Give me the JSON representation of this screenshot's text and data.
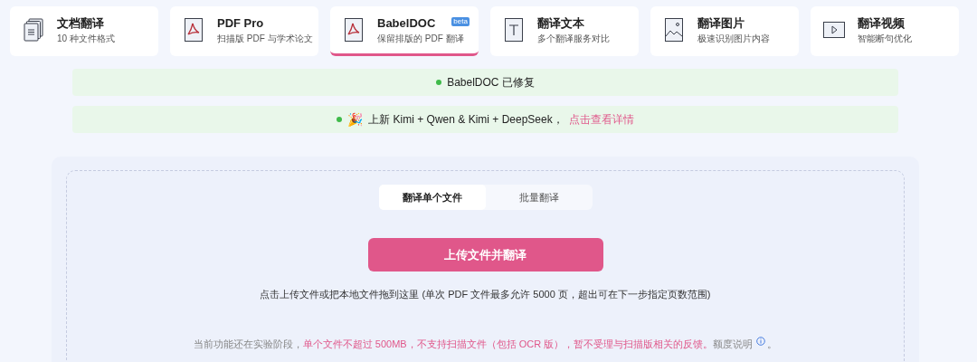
{
  "tools": [
    {
      "kind": "docs",
      "title": "文档翻译",
      "subtitle": "10 种文件格式",
      "selected": false
    },
    {
      "kind": "pdf",
      "title": "PDF Pro",
      "subtitle": "扫描版 PDF 与学术论文",
      "selected": false
    },
    {
      "kind": "pdf",
      "title": "BabelDOC",
      "subtitle": "保留排版的 PDF 翻译",
      "badge": "beta",
      "selected": true
    },
    {
      "kind": "text",
      "title": "翻译文本",
      "subtitle": "多个翻译服务对比",
      "selected": false
    },
    {
      "kind": "image",
      "title": "翻译图片",
      "subtitle": "极速识别图片内容",
      "selected": false
    },
    {
      "kind": "video",
      "title": "翻译视频",
      "subtitle": "智能断句优化",
      "selected": false
    }
  ],
  "notices": [
    {
      "color": "#3fba4a",
      "text": "BabelDOC 已修复"
    },
    {
      "color": "#3fba4a",
      "emoji": "🎉",
      "text": "上新 Kimi + Qwen & Kimi + DeepSeek，",
      "link": "点击查看详情"
    }
  ],
  "mode_tabs": [
    {
      "label": "翻译单个文件",
      "selected": true
    },
    {
      "label": "批量翻译",
      "selected": false
    }
  ],
  "upload_button": "上传文件并翻译",
  "hint": "点击上传文件或把本地文件拖到这里 (单次 PDF 文件最多允许 5000 页，超出可在下一步指定页数范围)",
  "note": {
    "segments": [
      {
        "kind": "plain",
        "text": "当前功能还在实验阶段，"
      },
      {
        "kind": "warning",
        "text": "单个文件不超过 500MB，不支持扫描文件（包括 OCR 版），暂不受理与扫描版相关的反馈。"
      },
      {
        "kind": "plain",
        "text": "额度说明"
      }
    ],
    "after_icon": "。"
  }
}
